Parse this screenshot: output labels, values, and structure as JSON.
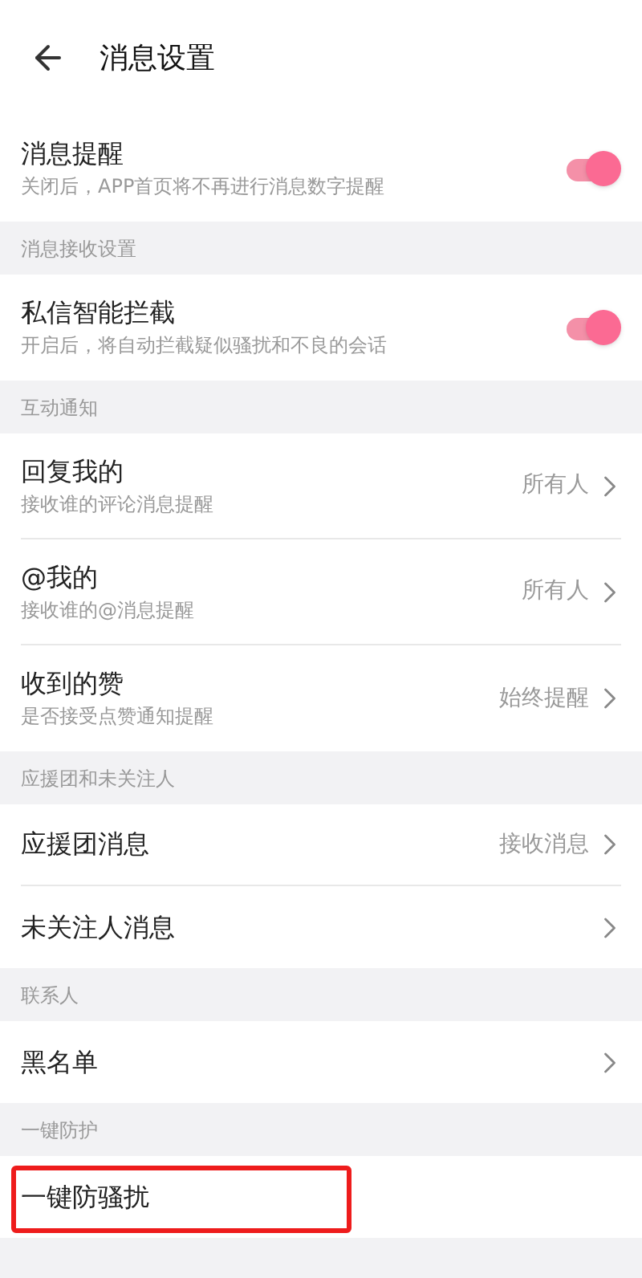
{
  "header": {
    "title": "消息设置"
  },
  "sections": [
    {
      "rows": [
        {
          "kind": "toggle",
          "title": "消息提醒",
          "subtitle": "关闭后，APP首页将不再进行消息数字提醒",
          "on": true
        }
      ]
    },
    {
      "heading": "消息接收设置",
      "rows": [
        {
          "kind": "toggle",
          "title": "私信智能拦截",
          "subtitle": "开启后，将自动拦截疑似骚扰和不良的会话",
          "on": true
        }
      ]
    },
    {
      "heading": "互动通知",
      "rows": [
        {
          "kind": "link",
          "title": "回复我的",
          "subtitle": "接收谁的评论消息提醒",
          "value": "所有人"
        },
        {
          "kind": "link",
          "title": "@我的",
          "subtitle": "接收谁的@消息提醒",
          "value": "所有人"
        },
        {
          "kind": "link",
          "title": "收到的赞",
          "subtitle": "是否接受点赞通知提醒",
          "value": "始终提醒"
        }
      ]
    },
    {
      "heading": "应援团和未关注人",
      "rows": [
        {
          "kind": "link",
          "title": "应援团消息",
          "value": "接收消息"
        },
        {
          "kind": "link",
          "title": "未关注人消息"
        }
      ]
    },
    {
      "heading": "联系人",
      "rows": [
        {
          "kind": "link",
          "title": "黑名单"
        }
      ]
    },
    {
      "heading": "一键防护",
      "rows": [
        {
          "kind": "plain",
          "title": "一键防骚扰",
          "highlighted": true
        }
      ]
    }
  ]
}
